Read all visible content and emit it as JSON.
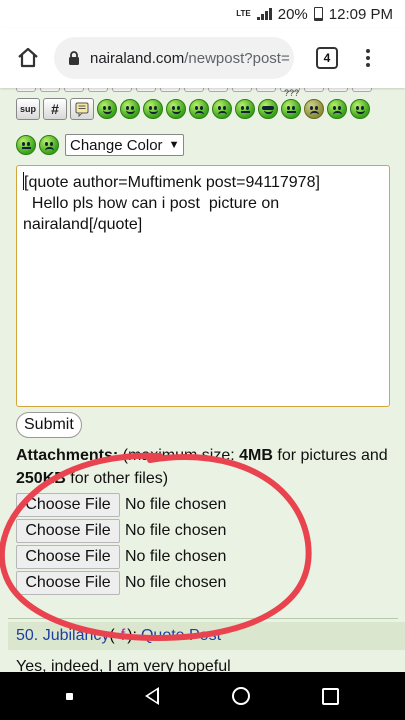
{
  "status_bar": {
    "network": "LTE",
    "battery": "20%",
    "time": "12:09 PM"
  },
  "browser": {
    "url_host": "nairaland.com",
    "url_path": "/newpost?post=",
    "tab_count": "4"
  },
  "toolbar": {
    "sup_label": "sup",
    "hash_label": "#",
    "dizzy_marks": "???",
    "smileys": [
      "smile",
      "wink",
      "cheesy",
      "grin",
      "angry",
      "sad",
      "shocked",
      "cool",
      "confused",
      "dizzy",
      "disgusted",
      "embarassed",
      "undecided",
      "cry"
    ],
    "change_color_label": "Change Color",
    "change_color_caret": "▼"
  },
  "editor": {
    "text": "[quote author=Muftimenk post=94117978]\n  Hello pls how can i post  picture on nairaland[/quote]"
  },
  "form": {
    "submit_label": "Submit",
    "attachments_label": "Attachments:",
    "attachments_note_1": " (maximum size: ",
    "attachments_pictures_limit": "4MB",
    "attachments_note_2": " for pictures and ",
    "attachments_other_limit": "250KB",
    "attachments_note_3": " for other files)",
    "file_inputs": [
      {
        "button": "Choose File",
        "status": "No file chosen"
      },
      {
        "button": "Choose File",
        "status": "No file chosen"
      },
      {
        "button": "Choose File",
        "status": "No file chosen"
      },
      {
        "button": "Choose File",
        "status": "No file chosen"
      }
    ]
  },
  "next_post": {
    "number": "50.",
    "author": "Jubilancy",
    "gender": "f",
    "action": "Quote Post",
    "body_preview": "Yes, indeed, I am very hopeful"
  },
  "colors": {
    "page_background": "#eaf2e3",
    "editor_border": "#d4a53a",
    "link_blue": "#1f3f9e",
    "annotation_red": "#e8434f"
  }
}
